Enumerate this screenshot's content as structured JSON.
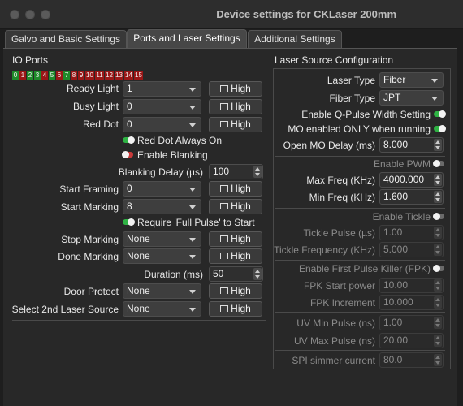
{
  "window": {
    "title": "Device settings for CKLaser 200mm"
  },
  "tabs": [
    {
      "label": "Galvo and Basic Settings",
      "active": false
    },
    {
      "label": "Ports and Laser Settings",
      "active": true
    },
    {
      "label": "Additional Settings",
      "active": false
    }
  ],
  "io": {
    "title": "IO Ports",
    "ports": [
      {
        "label": "0",
        "color": "#1f8a2a"
      },
      {
        "label": "1",
        "color": "#9a1616"
      },
      {
        "label": "2",
        "color": "#1f8a2a"
      },
      {
        "label": "3",
        "color": "#1f8a2a"
      },
      {
        "label": "4",
        "color": "#9a1616"
      },
      {
        "label": "5",
        "color": "#1f8a2a"
      },
      {
        "label": "6",
        "color": "#9a1616"
      },
      {
        "label": "7",
        "color": "#1f8a2a"
      },
      {
        "label": "8",
        "color": "#9a1616"
      },
      {
        "label": "9",
        "color": "#9a1616"
      },
      {
        "label": "10",
        "color": "#9a1616"
      },
      {
        "label": "11",
        "color": "#9a1616"
      },
      {
        "label": "12",
        "color": "#9a1616"
      },
      {
        "label": "13",
        "color": "#9a1616"
      },
      {
        "label": "14",
        "color": "#9a1616"
      },
      {
        "label": "15",
        "color": "#9a1616"
      }
    ],
    "high_label": "High",
    "ready_light": {
      "label": "Ready Light",
      "value": "1"
    },
    "busy_light": {
      "label": "Busy Light",
      "value": "0"
    },
    "red_dot": {
      "label": "Red Dot",
      "value": "0"
    },
    "red_dot_always_on": {
      "label": "Red Dot Always On",
      "on": true
    },
    "enable_blanking": {
      "label": "Enable Blanking",
      "on": false
    },
    "blanking_delay": {
      "label": "Blanking Delay (µs)",
      "value": "100"
    },
    "start_framing": {
      "label": "Start Framing",
      "value": "0"
    },
    "start_marking": {
      "label": "Start Marking",
      "value": "8"
    },
    "require_full_pulse": {
      "label": "Require 'Full Pulse' to Start",
      "on": true
    },
    "stop_marking": {
      "label": "Stop Marking",
      "value": "None"
    },
    "done_marking": {
      "label": "Done Marking",
      "value": "None"
    },
    "duration": {
      "label": "Duration (ms)",
      "value": "50"
    },
    "door_protect": {
      "label": "Door Protect",
      "value": "None"
    },
    "second_laser": {
      "label": "Select 2nd Laser Source",
      "value": "None"
    }
  },
  "laser": {
    "title": "Laser Source Configuration",
    "laser_type": {
      "label": "Laser Type",
      "value": "Fiber"
    },
    "fiber_type": {
      "label": "Fiber Type",
      "value": "JPT"
    },
    "q_pulse": {
      "label": "Enable Q-Pulse Width Setting",
      "on": true
    },
    "mo_enabled": {
      "label": "MO enabled ONLY when running",
      "on": true
    },
    "open_mo_delay": {
      "label": "Open MO Delay (ms)",
      "value": "8.000"
    },
    "enable_pwm": {
      "label": "Enable PWM",
      "on": false
    },
    "max_freq": {
      "label": "Max Freq (KHz)",
      "value": "4000.000"
    },
    "min_freq": {
      "label": "Min Freq (KHz)",
      "value": "1.600"
    },
    "enable_tickle": {
      "label": "Enable Tickle",
      "on": false
    },
    "tickle_pulse": {
      "label": "Tickle Pulse (µs)",
      "value": "1.00"
    },
    "tickle_freq": {
      "label": "Tickle Frequency (KHz)",
      "value": "5.000"
    },
    "fpk": {
      "label": "Enable First Pulse Killer (FPK)",
      "on": false
    },
    "fpk_start_power": {
      "label": "FPK Start power",
      "value": "10.00"
    },
    "fpk_increment": {
      "label": "FPK Increment",
      "value": "10.000"
    },
    "uv_min": {
      "label": "UV Min Pulse (ns)",
      "value": "1.00"
    },
    "uv_max": {
      "label": "UV Max Pulse (ns)",
      "value": "20.00"
    },
    "spi_simmer": {
      "label": "SPI simmer current",
      "value": "80.0"
    }
  },
  "colors": {
    "toggle_on": "#2fb344",
    "toggle_off": "#6a6a6a",
    "port_on": "#1f8a2a",
    "port_off": "#9a1616"
  }
}
